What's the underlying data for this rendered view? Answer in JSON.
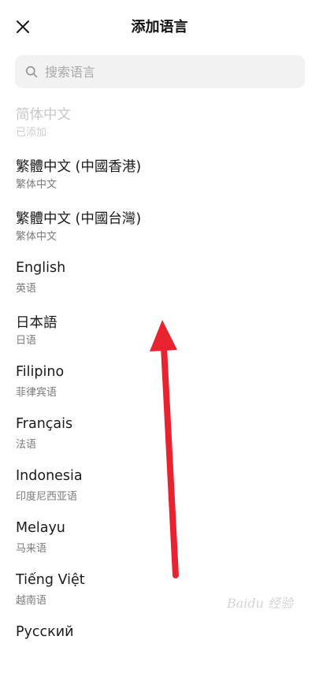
{
  "header": {
    "title": "添加语言",
    "close_icon": "close-icon"
  },
  "search": {
    "placeholder": "搜索语言",
    "icon": "search-icon"
  },
  "languages": [
    {
      "name": "简体中文",
      "sub": "已添加",
      "disabled": true
    },
    {
      "name": "繁體中文 (中國香港)",
      "sub": "繁体中文"
    },
    {
      "name": "繁體中文 (中國台灣)",
      "sub": "繁体中文"
    },
    {
      "name": "English",
      "sub": "英语"
    },
    {
      "name": "日本語",
      "sub": "日语"
    },
    {
      "name": "Filipino",
      "sub": "菲律宾语"
    },
    {
      "name": "Français",
      "sub": "法语"
    },
    {
      "name": "Indonesia",
      "sub": "印度尼西亚语"
    },
    {
      "name": "Melayu",
      "sub": "马来语"
    },
    {
      "name": "Tiếng Việt",
      "sub": "越南语"
    },
    {
      "name": "Русский",
      "sub": ""
    }
  ],
  "colors": {
    "arrow": "#e8232f",
    "search_bg": "#f2f2f2"
  },
  "watermark": {
    "text": "Baidu 经验"
  }
}
